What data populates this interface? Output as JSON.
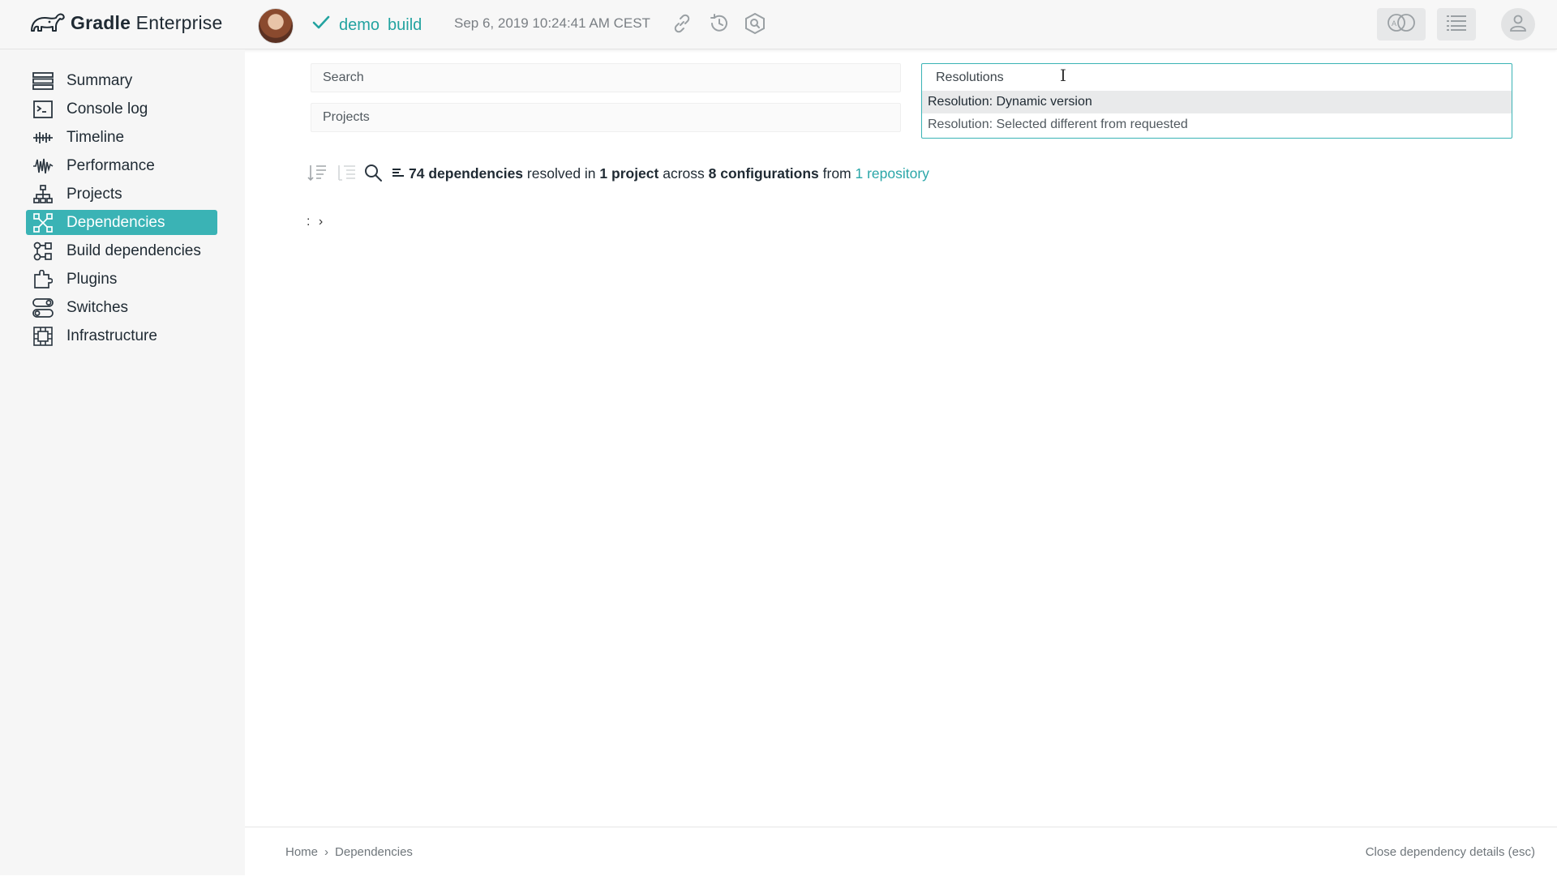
{
  "app": {
    "brand_bold": "Gradle",
    "brand_light": " Enterprise"
  },
  "build": {
    "status_icon": "check-icon",
    "tags": [
      "demo",
      "build"
    ],
    "timestamp": "Sep 6, 2019 10:24:41 AM CEST",
    "accent": "#23a3a0"
  },
  "sidebar": {
    "active_color": "#3ab3b5",
    "items": [
      {
        "label": "Summary",
        "icon": "summary-icon"
      },
      {
        "label": "Console log",
        "icon": "console-icon"
      },
      {
        "label": "Timeline",
        "icon": "timeline-icon"
      },
      {
        "label": "Performance",
        "icon": "performance-icon"
      },
      {
        "label": "Projects",
        "icon": "projects-icon"
      },
      {
        "label": "Dependencies",
        "icon": "dependencies-icon",
        "active": true
      },
      {
        "label": "Build dependencies",
        "icon": "build-dependencies-icon"
      },
      {
        "label": "Plugins",
        "icon": "plugins-icon"
      },
      {
        "label": "Switches",
        "icon": "switches-icon"
      },
      {
        "label": "Infrastructure",
        "icon": "infrastructure-icon"
      }
    ]
  },
  "filters": {
    "search_placeholder": "Search",
    "projects_placeholder": "Projects",
    "resolutions": {
      "title": "Resolutions",
      "options": [
        "Resolution: Dynamic version",
        "Resolution: Selected different from requested"
      ]
    }
  },
  "summary": {
    "count": "74 dependencies",
    "t1": " resolved in ",
    "projects": "1 project",
    "t2": " across ",
    "configs": "8 configurations",
    "t3": " from ",
    "repos": "1 repository"
  },
  "tree": {
    "row_text": ":",
    "expander": "›"
  },
  "footer": {
    "crumb_home": "Home",
    "crumb_sep": "›",
    "crumb_current": "Dependencies",
    "close_text": "Close dependency details (esc)"
  }
}
